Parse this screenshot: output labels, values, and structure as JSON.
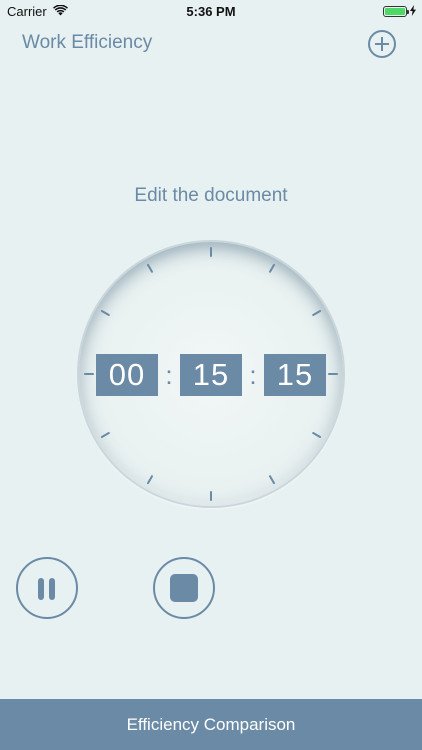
{
  "status_bar": {
    "carrier": "Carrier",
    "time": "5:36 PM",
    "battery_color": "#4cd964",
    "signal_icon": "wifi-icon",
    "charging_icon": "bolt-icon"
  },
  "header": {
    "title": "Work Efficiency",
    "add_icon": "plus-circle-icon"
  },
  "task": {
    "title": "Edit the document"
  },
  "timer": {
    "hours": "00",
    "minutes": "15",
    "seconds": "15",
    "separator": ":"
  },
  "controls": {
    "pause_icon": "pause-icon",
    "stop_icon": "stop-icon"
  },
  "footer": {
    "label": "Efficiency Comparison"
  },
  "colors": {
    "accent": "#6a8aa6",
    "background": "#e8f1f1"
  }
}
